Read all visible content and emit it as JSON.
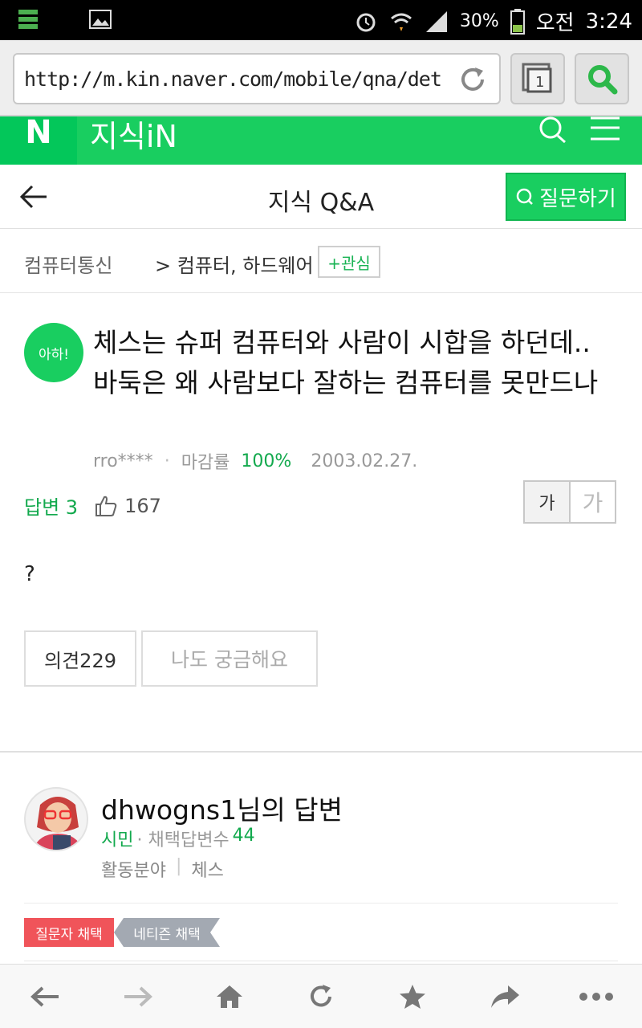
{
  "statusbar": {
    "battery": "30%",
    "ampm": "오전",
    "time": "3:24"
  },
  "browser": {
    "url": "http://m.kin.naver.com/mobile/qna/det...",
    "tab_count": "1"
  },
  "naver": {
    "logo": "N",
    "service": "지식iN"
  },
  "header": {
    "title": "지식 Q&A",
    "ask_label": "질문하기"
  },
  "breadcrumb": {
    "category": "컴퓨터통신",
    "subcategory": "> 컴퓨터, 하드웨어",
    "follow_label": "+관심"
  },
  "question": {
    "badge": "아하!",
    "title": "체스는 슈퍼 컴퓨터와 사람이 시합을 하던데.. 바둑은 왜 사람보다 잘하는 컴퓨터를 못만드나",
    "author": "rro****",
    "close_rate_label": "마감률",
    "close_rate": "100%",
    "date": "2003.02.27.",
    "answers_label": "답변 3",
    "likes": "167",
    "font_small": "가",
    "font_large": "가",
    "body": "?",
    "opinion_label": "의견229",
    "curious_label": "나도 궁금해요"
  },
  "answer": {
    "name": "dhwogns1님의 답변",
    "level": "시민",
    "selected_label": "· 채택답변수",
    "selected_count": "44",
    "field_label": "활동분야",
    "field_value": "체스",
    "tag_asker": "질문자 채택",
    "tag_netizen": "네티즌 채택"
  },
  "colors": {
    "naver_green": "#19ce60",
    "asker_tag": "#f0545a",
    "netizen_tag": "#a3a9b2"
  }
}
